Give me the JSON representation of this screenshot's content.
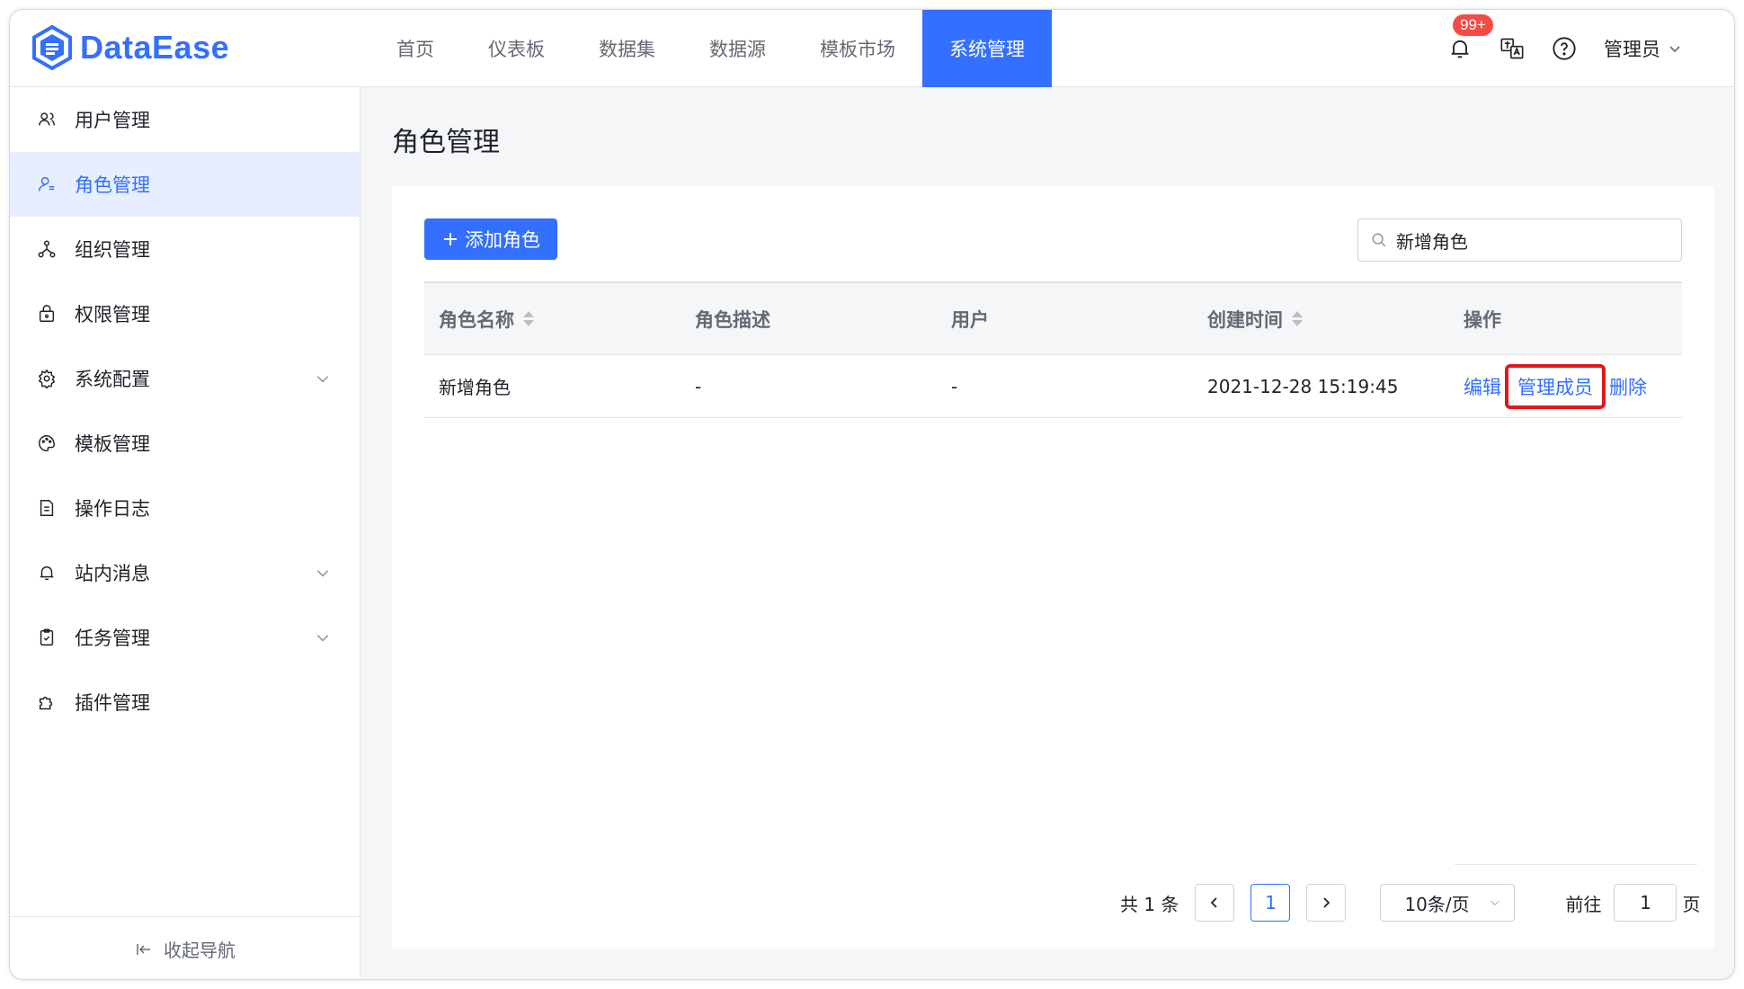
{
  "app": {
    "logo_text": "DataEase"
  },
  "nav": [
    {
      "label": "首页"
    },
    {
      "label": "仪表板"
    },
    {
      "label": "数据集"
    },
    {
      "label": "数据源"
    },
    {
      "label": "模板市场"
    },
    {
      "label": "系统管理",
      "active": true
    }
  ],
  "header": {
    "notification_badge": "99+",
    "user_name": "管理员"
  },
  "sidebar": {
    "items": [
      {
        "label": "用户管理",
        "icon": "users-icon"
      },
      {
        "label": "角色管理",
        "icon": "role-icon",
        "active": true
      },
      {
        "label": "组织管理",
        "icon": "org-icon"
      },
      {
        "label": "权限管理",
        "icon": "lock-icon"
      },
      {
        "label": "系统配置",
        "icon": "gear-icon",
        "expandable": true
      },
      {
        "label": "模板管理",
        "icon": "palette-icon"
      },
      {
        "label": "操作日志",
        "icon": "document-icon"
      },
      {
        "label": "站内消息",
        "icon": "bell-icon",
        "expandable": true
      },
      {
        "label": "任务管理",
        "icon": "clipboard-icon",
        "expandable": true
      },
      {
        "label": "插件管理",
        "icon": "puzzle-icon"
      }
    ],
    "collapse_label": "收起导航"
  },
  "page": {
    "title": "角色管理"
  },
  "toolbar": {
    "add_label": "添加角色",
    "search_value": "新增角色"
  },
  "table": {
    "headers": [
      "角色名称",
      "角色描述",
      "用户",
      "创建时间",
      "操作"
    ],
    "rows": [
      {
        "name": "新增角色",
        "desc": "-",
        "users": "-",
        "created": "2021-12-28 15:19:45",
        "actions": {
          "edit": "编辑",
          "members": "管理成员",
          "delete": "删除"
        }
      }
    ]
  },
  "pagination": {
    "total": "共 1 条",
    "current": "1",
    "page_size": "10条/页",
    "goto_label": "前往",
    "goto_value": "1",
    "page_suffix": "页"
  },
  "colors": {
    "accent": "#3370ff",
    "highlight": "#e0181a",
    "badge": "#f54a45"
  }
}
